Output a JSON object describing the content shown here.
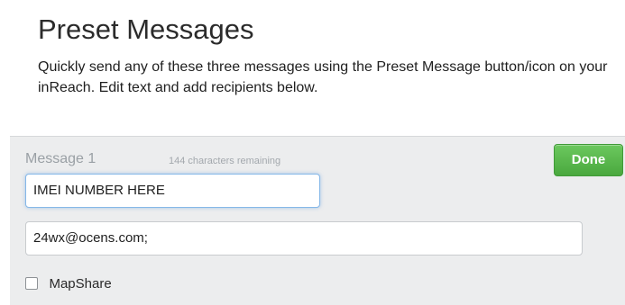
{
  "header": {
    "title": "Preset Messages",
    "description": "Quickly send any of these three messages using the Preset Message button/icon on your inReach. Edit text and add recipients below."
  },
  "message": {
    "label": "Message 1",
    "chars_remaining": "144 characters remaining",
    "text_value": "IMEI NUMBER HERE",
    "recipients_value": "24wx@ocens.com;",
    "done_label": "Done",
    "mapshare_label": "MapShare",
    "mapshare_checked": false
  },
  "colors": {
    "done_button": "#58b54b",
    "panel_background": "#ecedee",
    "focus_ring": "#86b8e8"
  }
}
